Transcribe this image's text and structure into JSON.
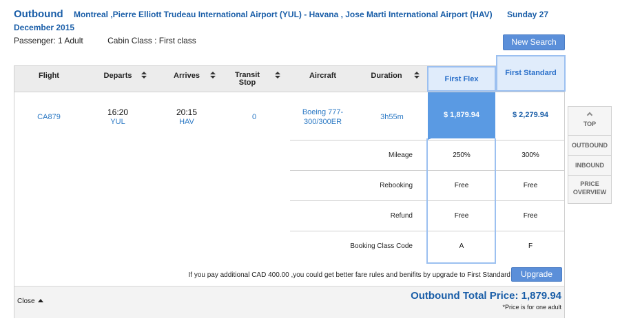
{
  "header": {
    "direction": "Outbound",
    "route": "Montreal ,Pierre Elliott Trudeau International Airport (YUL) - Havana , Jose Marti International Airport (HAV)",
    "date": "Sunday 27 December 2015"
  },
  "info": {
    "passenger": "Passenger: 1 Adult",
    "cabin": "Cabin Class : First class"
  },
  "buttons": {
    "new_search": "New Search",
    "upgrade": "Upgrade"
  },
  "columns": {
    "flight": "Flight",
    "departs": "Departs",
    "arrives": "Arrives",
    "transit": "Transit Stop",
    "aircraft": "Aircraft",
    "duration": "Duration",
    "fare1": "First Flex",
    "fare2": "First Standard"
  },
  "flight": {
    "number": "CA879",
    "depart_time": "16:20",
    "depart_code": "YUL",
    "arrive_time": "20:15",
    "arrive_code": "HAV",
    "transit": "0",
    "aircraft": "Boeing 777-300/300ER",
    "duration": "3h55m",
    "price_fare1": "$ 1,879.94",
    "price_fare2": "$ 2,279.94"
  },
  "fare_rules": [
    {
      "label": "Mileage",
      "fare1": "250%",
      "fare2": "300%"
    },
    {
      "label": "Rebooking",
      "fare1": "Free",
      "fare2": "Free"
    },
    {
      "label": "Refund",
      "fare1": "Free",
      "fare2": "Free"
    },
    {
      "label": "Booking Class Code",
      "fare1": "A",
      "fare2": "F"
    }
  ],
  "upgrade_message": "If you pay additional CAD 400.00 ,you could get better fare rules and benifits by upgrade to First Standard",
  "footer": {
    "close": "Close",
    "total": "Outbound Total Price: 1,879.94",
    "note": "*Price is for one adult"
  },
  "side_nav": {
    "top": "TOP",
    "outbound": "OUTBOUND",
    "inbound": "INBOUND",
    "overview": "PRICE OVERVIEW"
  },
  "colors": {
    "brand_blue": "#1a5ea8",
    "selected_fare": "#5a9ae3",
    "button": "#5b8fd9"
  }
}
